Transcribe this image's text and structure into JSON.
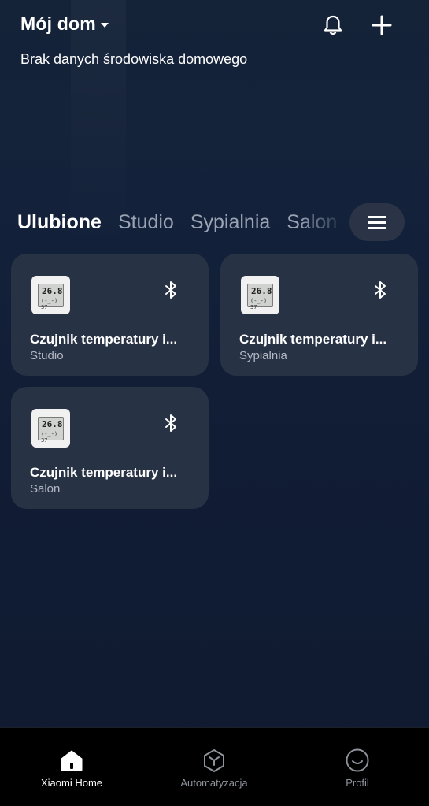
{
  "header": {
    "title": "Mój dom",
    "environment_text": "Brak danych środowiska domowego"
  },
  "tabs": [
    {
      "label": "Ulubione",
      "active": true
    },
    {
      "label": "Studio",
      "active": false
    },
    {
      "label": "Sypialnia",
      "active": false
    },
    {
      "label": "Salon",
      "active": false
    }
  ],
  "thermo_display": {
    "temp": "26.8",
    "hum": "(-_-) 37"
  },
  "devices": [
    {
      "name": "Czujnik temperatury i...",
      "room": "Studio"
    },
    {
      "name": "Czujnik temperatury i...",
      "room": "Sypialnia"
    },
    {
      "name": "Czujnik temperatury i...",
      "room": "Salon"
    }
  ],
  "bottom_nav": [
    {
      "label": "Xiaomi Home",
      "icon": "home-icon",
      "active": true
    },
    {
      "label": "Automatyzacja",
      "icon": "automation-icon",
      "active": false
    },
    {
      "label": "Profil",
      "icon": "profile-icon",
      "active": false
    }
  ],
  "colors": {
    "background": "#111d35",
    "card": "#283245",
    "active_text": "#ffffff",
    "inactive_tab": "#9aa3b3",
    "nav_background": "#000000"
  }
}
